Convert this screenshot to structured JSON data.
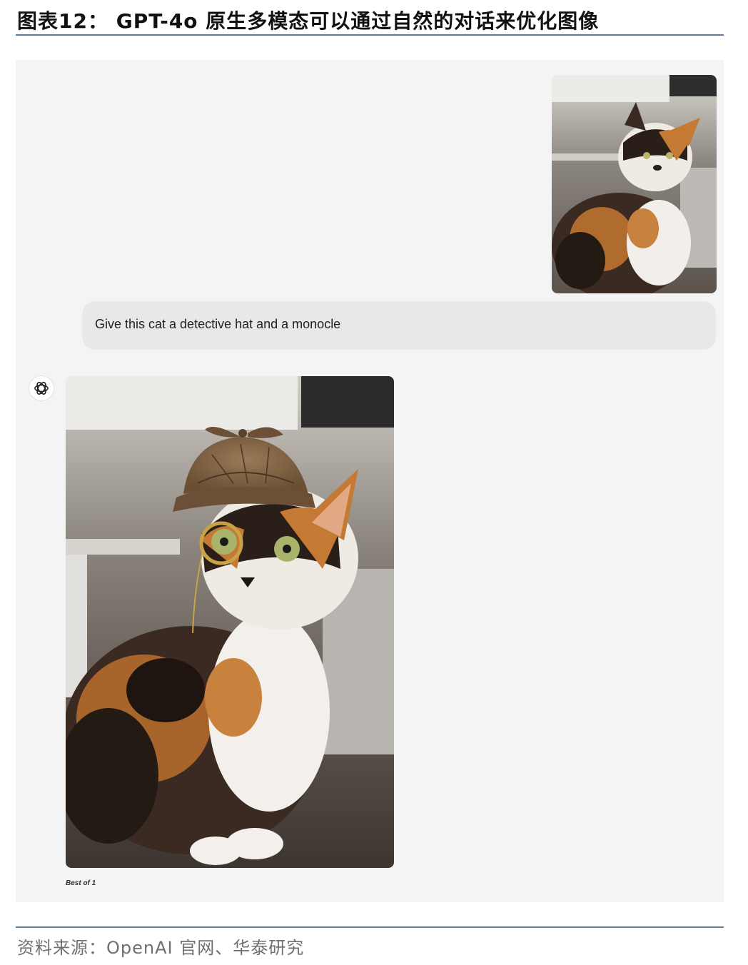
{
  "figure": {
    "title": "图表12： GPT-4o 原生多模态可以通过自然的对话来优化图像"
  },
  "chat": {
    "user_message": "Give this cat a detective hat and a monocle",
    "generation_caption": "Best of 1"
  },
  "images": {
    "user_upload": "calico cat sitting in kitchen",
    "generated": "calico cat wearing deerstalker hat and monocle"
  },
  "icons": {
    "assistant_avatar": "openai-logo-icon"
  },
  "footer": {
    "source": "资料来源：OpenAI 官网、华泰研究"
  },
  "colors": {
    "rule": "#5e7d99",
    "chat_background": "#f4f4f4",
    "bubble_background": "#e8e8e8"
  }
}
